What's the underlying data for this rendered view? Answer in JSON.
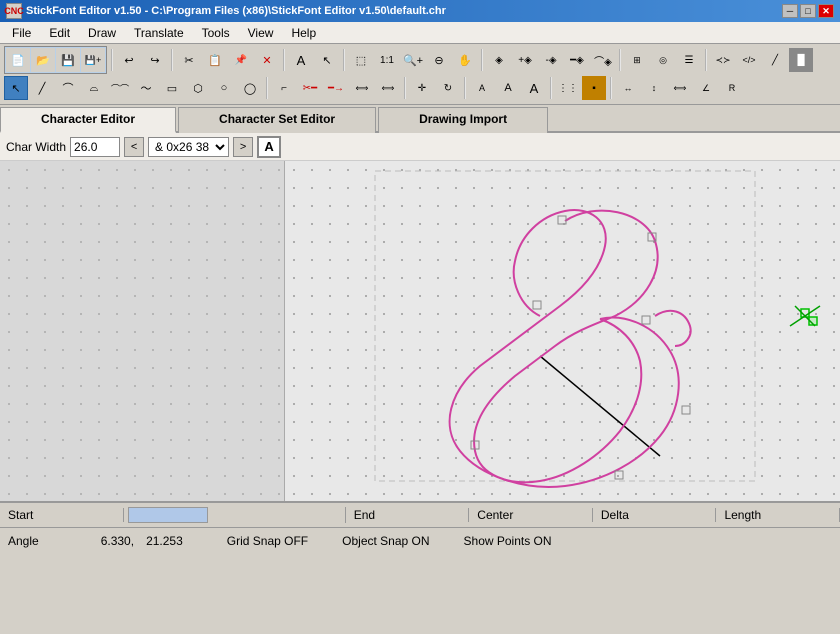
{
  "window": {
    "title": "StickFont Editor v1.50 - C:\\Program Files (x86)\\StickFont Editor v1.50\\default.chr",
    "icon": "cnc-icon"
  },
  "titlebar": {
    "minimize_label": "─",
    "restore_label": "□",
    "close_label": "✕"
  },
  "menubar": {
    "items": [
      {
        "id": "file",
        "label": "File"
      },
      {
        "id": "edit",
        "label": "Edit"
      },
      {
        "id": "draw",
        "label": "Draw"
      },
      {
        "id": "translate",
        "label": "Translate"
      },
      {
        "id": "tools",
        "label": "Tools"
      },
      {
        "id": "view",
        "label": "View"
      },
      {
        "id": "help",
        "label": "Help"
      }
    ]
  },
  "tabs": {
    "items": [
      {
        "id": "character-editor",
        "label": "Character Editor",
        "active": true
      },
      {
        "id": "character-set-editor",
        "label": "Character Set Editor",
        "active": false
      },
      {
        "id": "drawing-import",
        "label": "Drawing Import",
        "active": false
      }
    ]
  },
  "char_editor": {
    "char_width_label": "Char Width",
    "char_width_value": "26.0",
    "nav_prev": "<",
    "nav_next": ">",
    "char_code": "& 0x26  38",
    "font_btn_label": "A"
  },
  "status": {
    "row1": {
      "start_label": "Start",
      "end_label": "End",
      "center_label": "Center",
      "delta_label": "Delta",
      "length_label": "Length"
    },
    "row2": {
      "angle_label": "Angle",
      "coord_x": "6.330,",
      "coord_y": "21.253",
      "grid_snap": "Grid Snap OFF",
      "object_snap": "Object Snap ON",
      "show_points": "Show Points ON"
    }
  },
  "toolbar": {
    "row1_icons": [
      "new-file",
      "open-file",
      "save-file",
      "save-as",
      "undo",
      "redo",
      "cut",
      "copy",
      "paste",
      "delete",
      "select-text",
      "select-arrow",
      "zoom-window",
      "zoom-actual",
      "zoom-in",
      "zoom-out",
      "pan",
      "separator",
      "node-select",
      "node-add",
      "node-delete",
      "line",
      "arc",
      "circle",
      "ellipse",
      "separator",
      "snap-grid",
      "snap-object",
      "layer"
    ],
    "row2_icons": [
      "line-tool",
      "angle-line",
      "curve",
      "arc-tool",
      "arc2",
      "spline",
      "rectangle",
      "polygon",
      "circle-tool",
      "ellipse-tool",
      "fillet",
      "trim",
      "extend",
      "offset",
      "separator",
      "text-small",
      "text-medium",
      "text-large",
      "separator",
      "hatch",
      "hatch2",
      "separator",
      "insert",
      "block",
      "separator",
      "dimension",
      "dim2",
      "separator",
      "properties"
    ]
  }
}
